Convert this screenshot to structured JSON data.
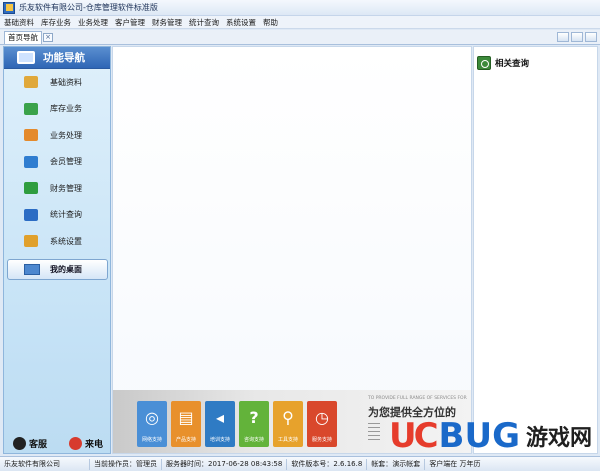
{
  "window": {
    "title": "乐友软件有限公司-仓库管理软件标准版"
  },
  "menu": [
    "基础资料",
    "库存业务",
    "业务处理",
    "客户管理",
    "财务管理",
    "统计查询",
    "系统设置",
    "帮助"
  ],
  "tabs": {
    "active": "首页导航",
    "close_glyph": "×"
  },
  "sidebar": {
    "header": "功能导航",
    "items": [
      {
        "label": "基础资料",
        "icon": "pencil-note-icon",
        "color": "#e0a83a"
      },
      {
        "label": "库存业务",
        "icon": "house-icon",
        "color": "#3aa24a"
      },
      {
        "label": "业务处理",
        "icon": "cart-icon",
        "color": "#e48a2c"
      },
      {
        "label": "会员管理",
        "icon": "users-icon",
        "color": "#2f7dd0"
      },
      {
        "label": "财务管理",
        "icon": "finance-chart-icon",
        "color": "#2f9d3f"
      },
      {
        "label": "统计查询",
        "icon": "bar-chart-icon",
        "color": "#2b6cc4"
      },
      {
        "label": "系统设置",
        "icon": "gear-icon",
        "color": "#e0a02c"
      }
    ],
    "desktop": "我的桌面",
    "bottom": [
      {
        "label": "客服",
        "icon": "qq-icon",
        "color": "#222222"
      },
      {
        "label": "来电",
        "icon": "phone-icon",
        "color": "#d73b2e"
      }
    ]
  },
  "banner": {
    "english": "TO PROVIDE FULL RANGE OF SERVICES FOR",
    "chinese": "为您提供全方位的",
    "tiles": [
      {
        "label": "网络支持",
        "color": "#4a8fd6",
        "glyph": "◎"
      },
      {
        "label": "产品支持",
        "color": "#e8902c",
        "glyph": "▤"
      },
      {
        "label": "培训支持",
        "color": "#2f7bc4",
        "glyph": "◂"
      },
      {
        "label": "咨询支持",
        "color": "#63b33a",
        "glyph": "?"
      },
      {
        "label": "工具支持",
        "color": "#e7a22c",
        "glyph": "⚲"
      },
      {
        "label": "服务支持",
        "color": "#d9482c",
        "glyph": "◷"
      }
    ]
  },
  "right_panel": {
    "title": "相关查询"
  },
  "watermark": {
    "brand": [
      "U",
      "C",
      "BUG"
    ],
    "cn": "游戏网"
  },
  "status": {
    "company": "乐友软件有限公司",
    "operator_label": "当前操作员：",
    "operator": "管理员",
    "server_time_label": "服务器时间：",
    "server_time": "2017-06-28 08:43:58",
    "version_label": "软件版本号：",
    "version": "2.6.16.8",
    "account_label": "帐套：",
    "account": "演示帐套",
    "tail": "客户端在 万年历"
  }
}
